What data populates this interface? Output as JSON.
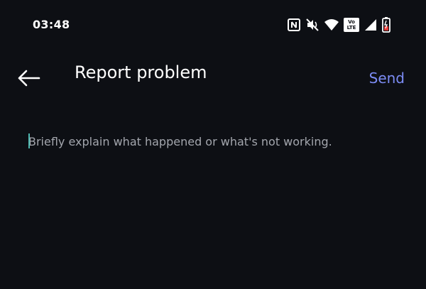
{
  "status_bar": {
    "time": "03:48",
    "volte_top": "Vo",
    "volte_bottom": "LTE",
    "icons": [
      "nfc-icon",
      "mute-icon",
      "wifi-icon",
      "volte-icon",
      "signal-icon",
      "battery-icon"
    ]
  },
  "app_bar": {
    "back_icon": "arrow-left-icon",
    "title": "Report problem",
    "send_label": "Send"
  },
  "form": {
    "description_value": "",
    "description_placeholder": "Briefly explain what happened or what's not working."
  },
  "colors": {
    "background": "#0d0f14",
    "accent": "#7c8cf5",
    "caret": "#4fb8b0",
    "placeholder": "#a3a6ad"
  }
}
